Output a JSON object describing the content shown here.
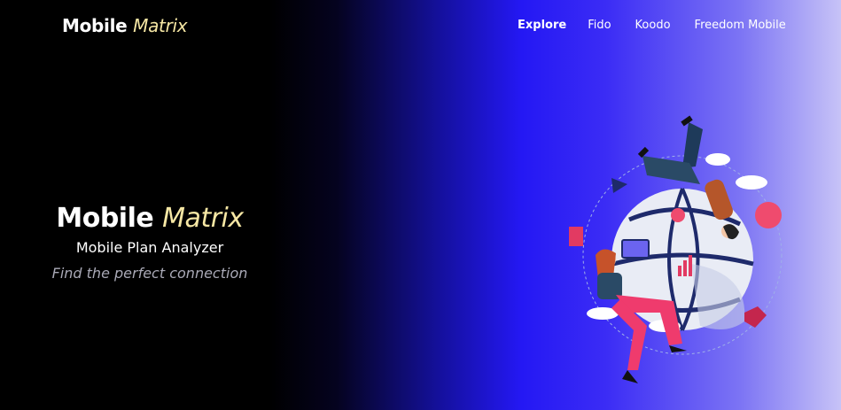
{
  "brand": {
    "name": "Mobile",
    "accent": "Matrix"
  },
  "nav": {
    "items": [
      {
        "label": "Explore",
        "active": true
      },
      {
        "label": "Fido",
        "active": false
      },
      {
        "label": "Koodo",
        "active": false
      },
      {
        "label": "Freedom Mobile",
        "active": false
      }
    ]
  },
  "hero": {
    "title_main": "Mobile",
    "title_accent": "Matrix",
    "subtitle": "Mobile Plan Analyzer",
    "tagline": "Find the perfect connection"
  },
  "colors": {
    "accent_text": "#f6e7a4",
    "background_left": "#000000",
    "background_mid": "#2418f4",
    "background_right": "#c7c3f7"
  },
  "illustration": {
    "icon": "globe-people-illustration"
  }
}
